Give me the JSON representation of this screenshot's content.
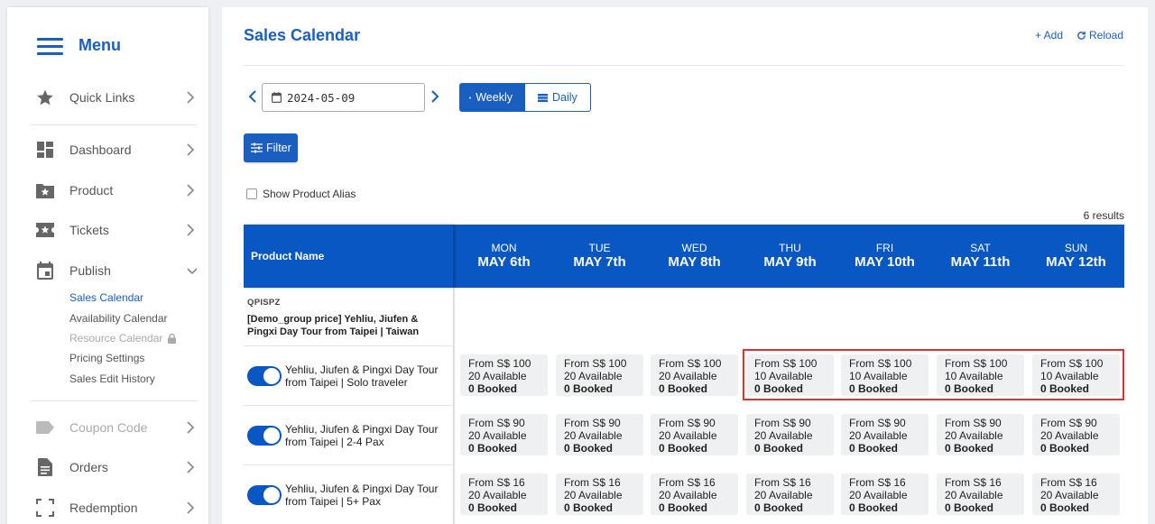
{
  "sidebar": {
    "menu_title": "Menu",
    "items": [
      {
        "label": "Quick Links",
        "icon": "star-icon"
      },
      {
        "label": "Dashboard",
        "icon": "dashboard-icon"
      },
      {
        "label": "Product",
        "icon": "folder-star-icon"
      },
      {
        "label": "Tickets",
        "icon": "ticket-icon"
      },
      {
        "label": "Publish",
        "icon": "calendar-icon"
      },
      {
        "label": "Coupon Code",
        "icon": "tag-icon"
      },
      {
        "label": "Orders",
        "icon": "document-icon"
      },
      {
        "label": "Redemption",
        "icon": "scan-icon"
      }
    ],
    "publish_sub": [
      {
        "label": "Sales Calendar"
      },
      {
        "label": "Availability Calendar"
      },
      {
        "label": "Resource Calendar"
      },
      {
        "label": "Pricing Settings"
      },
      {
        "label": "Sales Edit History"
      }
    ]
  },
  "header": {
    "title": "Sales Calendar",
    "add_label": "+ Add",
    "reload_label": "Reload"
  },
  "controls": {
    "date_value": "2024-05-09",
    "weekly_label": "Weekly",
    "daily_label": "Daily",
    "filter_label": "Filter",
    "alias_label": "Show Product Alias",
    "results_label": "6 results"
  },
  "table": {
    "product_header": "Product Name",
    "days": [
      {
        "dow": "MON",
        "date": "MAY 6th"
      },
      {
        "dow": "TUE",
        "date": "MAY 7th"
      },
      {
        "dow": "WED",
        "date": "MAY 8th"
      },
      {
        "dow": "THU",
        "date": "MAY 9th"
      },
      {
        "dow": "FRI",
        "date": "MAY 10th"
      },
      {
        "dow": "SAT",
        "date": "MAY 11th"
      },
      {
        "dow": "SUN",
        "date": "MAY 12th"
      }
    ],
    "group": {
      "code": "QPISPZ",
      "name": "[Demo_group price] Yehliu, Jiufen & Pingxi Day Tour from Taipei | Taiwan"
    },
    "rows": [
      {
        "name": "Yehliu, Jiufen & Pingxi Day Tour from Taipei | Solo traveler",
        "enabled": true,
        "cells": [
          {
            "price": "From S$ 100",
            "avail": "20 Available",
            "booked": "0 Booked"
          },
          {
            "price": "From S$ 100",
            "avail": "20 Available",
            "booked": "0 Booked"
          },
          {
            "price": "From S$ 100",
            "avail": "20 Available",
            "booked": "0 Booked"
          },
          {
            "price": "From S$ 100",
            "avail": "10 Available",
            "booked": "0 Booked"
          },
          {
            "price": "From S$ 100",
            "avail": "10 Available",
            "booked": "0 Booked"
          },
          {
            "price": "From S$ 100",
            "avail": "10 Available",
            "booked": "0 Booked"
          },
          {
            "price": "From S$ 100",
            "avail": "10 Available",
            "booked": "0 Booked"
          }
        ]
      },
      {
        "name": "Yehliu, Jiufen & Pingxi Day Tour from Taipei | 2-4 Pax",
        "enabled": true,
        "cells": [
          {
            "price": "From S$ 90",
            "avail": "20 Available",
            "booked": "0 Booked"
          },
          {
            "price": "From S$ 90",
            "avail": "20 Available",
            "booked": "0 Booked"
          },
          {
            "price": "From S$ 90",
            "avail": "20 Available",
            "booked": "0 Booked"
          },
          {
            "price": "From S$ 90",
            "avail": "20 Available",
            "booked": "0 Booked"
          },
          {
            "price": "From S$ 90",
            "avail": "20 Available",
            "booked": "0 Booked"
          },
          {
            "price": "From S$ 90",
            "avail": "20 Available",
            "booked": "0 Booked"
          },
          {
            "price": "From S$ 90",
            "avail": "20 Available",
            "booked": "0 Booked"
          }
        ]
      },
      {
        "name": "Yehliu, Jiufen & Pingxi Day Tour from Taipei | 5+ Pax",
        "enabled": true,
        "cells": [
          {
            "price": "From S$ 16",
            "avail": "20 Available",
            "booked": "0 Booked"
          },
          {
            "price": "From S$ 16",
            "avail": "20 Available",
            "booked": "0 Booked"
          },
          {
            "price": "From S$ 16",
            "avail": "20 Available",
            "booked": "0 Booked"
          },
          {
            "price": "From S$ 16",
            "avail": "20 Available",
            "booked": "0 Booked"
          },
          {
            "price": "From S$ 16",
            "avail": "20 Available",
            "booked": "0 Booked"
          },
          {
            "price": "From S$ 16",
            "avail": "20 Available",
            "booked": "0 Booked"
          },
          {
            "price": "From S$ 16",
            "avail": "20 Available",
            "booked": "0 Booked"
          }
        ]
      }
    ]
  },
  "colors": {
    "primary": "#1a5fc0",
    "header_blue": "#0857c3",
    "highlight": "#e03131",
    "cell_bg": "#eff0f2"
  }
}
